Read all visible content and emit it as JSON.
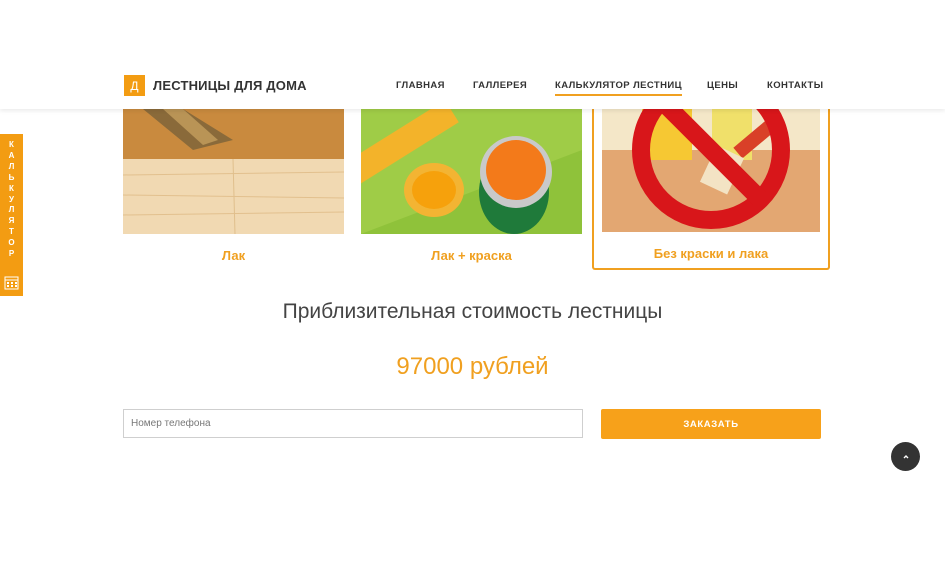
{
  "header": {
    "logo_letter": "Д",
    "logo_text": "ЛЕСТНИЦЫ ДЛЯ ДОМА",
    "nav": [
      {
        "label": "ГЛАВНАЯ"
      },
      {
        "label": "ГАЛЛЕРЕЯ"
      },
      {
        "label": "КАЛЬКУЛЯТОР ЛЕСТНИЦ",
        "active": true
      },
      {
        "label": "ЦЕНЫ"
      },
      {
        "label": "КОНТАКТЫ"
      }
    ]
  },
  "sidetab": {
    "label": "КАЛЬКУЛЯТОР",
    "icon": "calculator-icon"
  },
  "finish_options": [
    {
      "label": "Лак",
      "image": "varnish-brush-wood-image"
    },
    {
      "label": "Лак + краска",
      "image": "paint-cans-image"
    },
    {
      "label": "Без краски и лака",
      "image": "no-paint-sign-image",
      "selected": true
    }
  ],
  "estimate": {
    "title": "Приблизительная стоимость лестницы",
    "price": "97000 рублей"
  },
  "form": {
    "phone_placeholder": "Номер телефона",
    "phone_value": "",
    "submit_label": "ЗАКАЗАТЬ"
  },
  "scroll_top": {
    "icon": "chevron-up-icon"
  },
  "colors": {
    "accent": "#f39c12",
    "text_dark": "#333333",
    "scroll_button": "#333333"
  }
}
